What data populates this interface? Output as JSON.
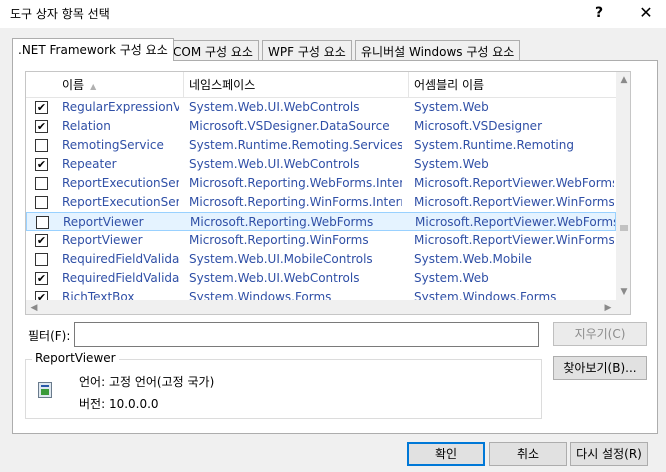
{
  "window": {
    "title": "도구 상자 항목 선택",
    "help_label": "?",
    "close_label": "✕"
  },
  "tabs": [
    {
      "label": ".NET Framework 구성 요소",
      "active": true
    },
    {
      "label": "COM 구성 요소",
      "active": false
    },
    {
      "label": "WPF 구성 요소",
      "active": false
    },
    {
      "label": "유니버설 Windows 구성 요소",
      "active": false
    }
  ],
  "list": {
    "columns": [
      "이름",
      "네임스페이스",
      "어셈블리 이름"
    ],
    "rows": [
      {
        "checked": true,
        "name": "RegularExpressionVali",
        "namespace": "System.Web.UI.WebControls",
        "assembly": "System.Web"
      },
      {
        "checked": true,
        "name": "Relation",
        "namespace": "Microsoft.VSDesigner.DataSource",
        "assembly": "Microsoft.VSDesigner"
      },
      {
        "checked": false,
        "name": "RemotingService",
        "namespace": "System.Runtime.Remoting.Services",
        "assembly": "System.Runtime.Remoting"
      },
      {
        "checked": true,
        "name": "Repeater",
        "namespace": "System.Web.UI.WebControls",
        "assembly": "System.Web"
      },
      {
        "checked": false,
        "name": "ReportExecutionServic",
        "namespace": "Microsoft.Reporting.WebForms.Internal.",
        "assembly": "Microsoft.ReportViewer.WebForms"
      },
      {
        "checked": false,
        "name": "ReportExecutionServic",
        "namespace": "Microsoft.Reporting.WinForms.Internal.S",
        "assembly": "Microsoft.ReportViewer.WinForms"
      },
      {
        "checked": false,
        "name": "ReportViewer",
        "namespace": "Microsoft.Reporting.WebForms",
        "assembly": "Microsoft.ReportViewer.WebForms",
        "selected": true
      },
      {
        "checked": true,
        "name": "ReportViewer",
        "namespace": "Microsoft.Reporting.WinForms",
        "assembly": "Microsoft.ReportViewer.WinForms"
      },
      {
        "checked": false,
        "name": "RequiredFieldValidato",
        "namespace": "System.Web.UI.MobileControls",
        "assembly": "System.Web.Mobile"
      },
      {
        "checked": true,
        "name": "RequiredFieldValidato",
        "namespace": "System.Web.UI.WebControls",
        "assembly": "System.Web"
      },
      {
        "checked": true,
        "name": "RichTextBox",
        "namespace": "System.Windows.Forms",
        "assembly": "System.Windows.Forms"
      }
    ]
  },
  "filter": {
    "label": "필터(F):",
    "value": "",
    "clear_label": "지우기(C)"
  },
  "details": {
    "group_title": "ReportViewer",
    "language_line": "언어:  고정 언어(고정 국가)",
    "version_line": "버전:  10.0.0.0",
    "browse_label": "찾아보기(B)...",
    "icon": "assembly-icon"
  },
  "footer": {
    "ok_label": "확인",
    "cancel_label": "취소",
    "reset_label": "다시 설정(R)"
  }
}
